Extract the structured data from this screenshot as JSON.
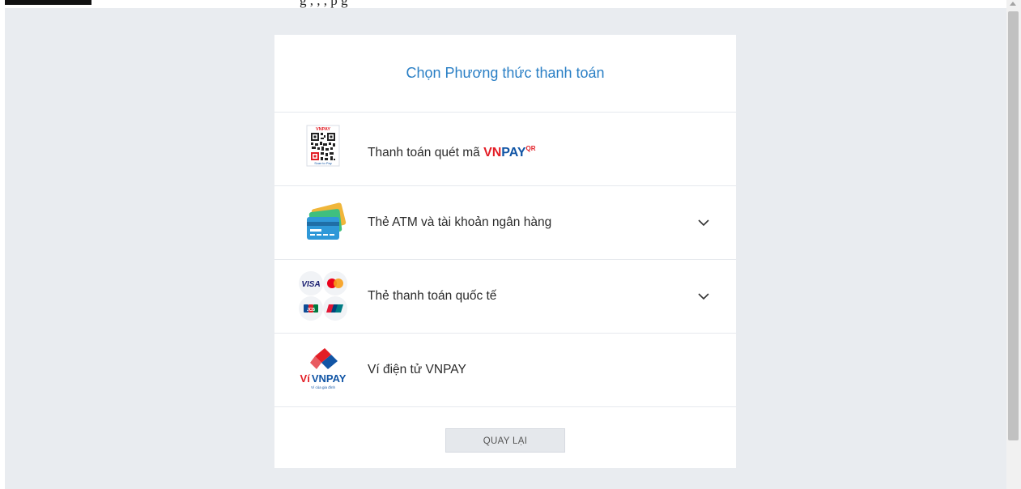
{
  "top_strip": {
    "partial_text": "g                                  , ,   ,  p    g"
  },
  "card": {
    "title": "Chọn Phương thức thanh toán",
    "methods": [
      {
        "id": "vnpayqr",
        "label": "Thanh toán quét mã",
        "brand_vn": "VN",
        "brand_pay": "PAY",
        "brand_qr": "QR",
        "icon": "vnpay-qr-icon",
        "qr_caption_top": "VNPAY",
        "qr_caption_bottom": "Scan to Pay"
      },
      {
        "id": "atm",
        "label": "Thẻ ATM và tài khoản ngân hàng",
        "icon": "bank-cards-icon",
        "expandable": true
      },
      {
        "id": "intl",
        "label": "Thẻ thanh toán quốc tế",
        "icon": "card-brands-icon",
        "expandable": true,
        "brands": {
          "visa": "VISA",
          "jcb": "JCB"
        }
      },
      {
        "id": "wallet",
        "label": "Ví điện tử VNPAY",
        "icon": "vnpay-wallet-icon",
        "logo_vi": "Ví",
        "logo_vnpay": "VNPAY",
        "logo_tagline": "Ví của gia đình"
      }
    ],
    "back_button": "QUAY LẠI"
  },
  "colors": {
    "title": "#2a7fc5",
    "background": "#e9ecf0",
    "vnpay_red": "#e31e26",
    "vnpay_blue": "#1155a5"
  }
}
